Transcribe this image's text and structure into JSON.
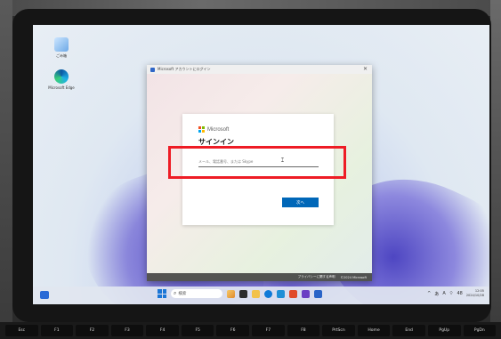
{
  "window": {
    "title": "Microsoft アカウントにログイン",
    "close_glyph": "✕"
  },
  "signin": {
    "brand": "Microsoft",
    "heading": "サインイン",
    "email_placeholder": "メール、電話番号、または Skype",
    "next_label": "次へ"
  },
  "footer": {
    "privacy": "プライバシーに関する声明",
    "copyright": "©2024 Microsoft"
  },
  "desktop": {
    "icons": [
      {
        "label": "ごみ箱",
        "icon": "recycle-bin-icon"
      },
      {
        "label": "Microsoft Edge",
        "icon": "edge-icon"
      }
    ]
  },
  "taskbar": {
    "search_text": "検索",
    "system": [
      "^",
      "あ",
      "A",
      "⌔",
      "48"
    ],
    "time": "12:05",
    "date": "2024/10/28"
  },
  "keyboard": [
    "Esc",
    "F1",
    "F2",
    "F3",
    "F4",
    "F5",
    "F6",
    "F7",
    "F8",
    "PrtScn",
    "Home",
    "End",
    "PgUp",
    "PgDn"
  ],
  "colors": {
    "accent": "#0067b8",
    "highlight": "#ee1c25",
    "ms_red": "#f25022",
    "ms_green": "#7fba00",
    "ms_blue": "#00a4ef",
    "ms_yellow": "#ffb900"
  }
}
